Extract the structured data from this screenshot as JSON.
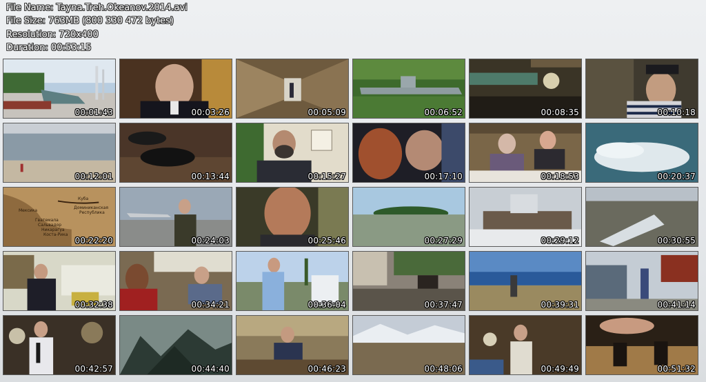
{
  "info": {
    "file_name": "File Name: Tayna.Treh.Okeanov.2014.avi",
    "file_size": "File Size: 763MB (800 330 472 bytes)",
    "resolution": "Resolution: 720x400",
    "duration": "Duration: 00:53:15"
  },
  "thumbnails": [
    {
      "time": "00:01:43",
      "scene": "submarine-monument-icon"
    },
    {
      "time": "00:03:26",
      "scene": "admiral-portrait-icon"
    },
    {
      "time": "00:05:09",
      "scene": "archive-corridor-icon"
    },
    {
      "time": "00:06:52",
      "scene": "submarine-s56-icon"
    },
    {
      "time": "00:08:35",
      "scene": "torpedo-room-icon"
    },
    {
      "time": "00:10:18",
      "scene": "sailor-cap-icon"
    },
    {
      "time": "00:12:01",
      "scene": "beach-coast-icon"
    },
    {
      "time": "00:13:44",
      "scene": "boots-icon"
    },
    {
      "time": "00:15:27",
      "scene": "bearded-man-icon"
    },
    {
      "time": "00:17:10",
      "scene": "two-people-reading-icon"
    },
    {
      "time": "00:18:53",
      "scene": "men-at-table-icon"
    },
    {
      "time": "00:20:37",
      "scene": "ship-wake-icon"
    },
    {
      "time": "00:22:20",
      "scene": "old-map-icon",
      "labels": [
        "Мексика",
        "Куба",
        "Доминиканская",
        "Республика",
        "Гватемала",
        "Сальвадор",
        "Никарагуа",
        "Коста-Рика"
      ]
    },
    {
      "time": "00:24:03",
      "scene": "airfield-host-icon"
    },
    {
      "time": "00:25:46",
      "scene": "man-closeup-icon"
    },
    {
      "time": "00:27:29",
      "scene": "island-sea-icon"
    },
    {
      "time": "00:29:12",
      "scene": "ship-in-ice-icon"
    },
    {
      "time": "00:30:55",
      "scene": "aerial-ship-icon"
    },
    {
      "time": "00:32:38",
      "scene": "library-man-icon"
    },
    {
      "time": "00:34:21",
      "scene": "computer-room-icon"
    },
    {
      "time": "00:36:04",
      "scene": "parade-street-icon"
    },
    {
      "time": "00:37:47",
      "scene": "carriage-street-icon"
    },
    {
      "time": "00:39:31",
      "scene": "shore-walker-icon"
    },
    {
      "time": "00:41:14",
      "scene": "ship-deck-walk-icon"
    },
    {
      "time": "00:42:57",
      "scene": "engine-room-host-icon"
    },
    {
      "time": "00:44:40",
      "scene": "misty-mountains-icon"
    },
    {
      "time": "00:46:23",
      "scene": "man-at-desk-icon"
    },
    {
      "time": "00:48:06",
      "scene": "snowy-landscape-icon"
    },
    {
      "time": "00:49:49",
      "scene": "cabin-instruments-icon"
    },
    {
      "time": "00:51:32",
      "scene": "chess-game-icon"
    }
  ]
}
